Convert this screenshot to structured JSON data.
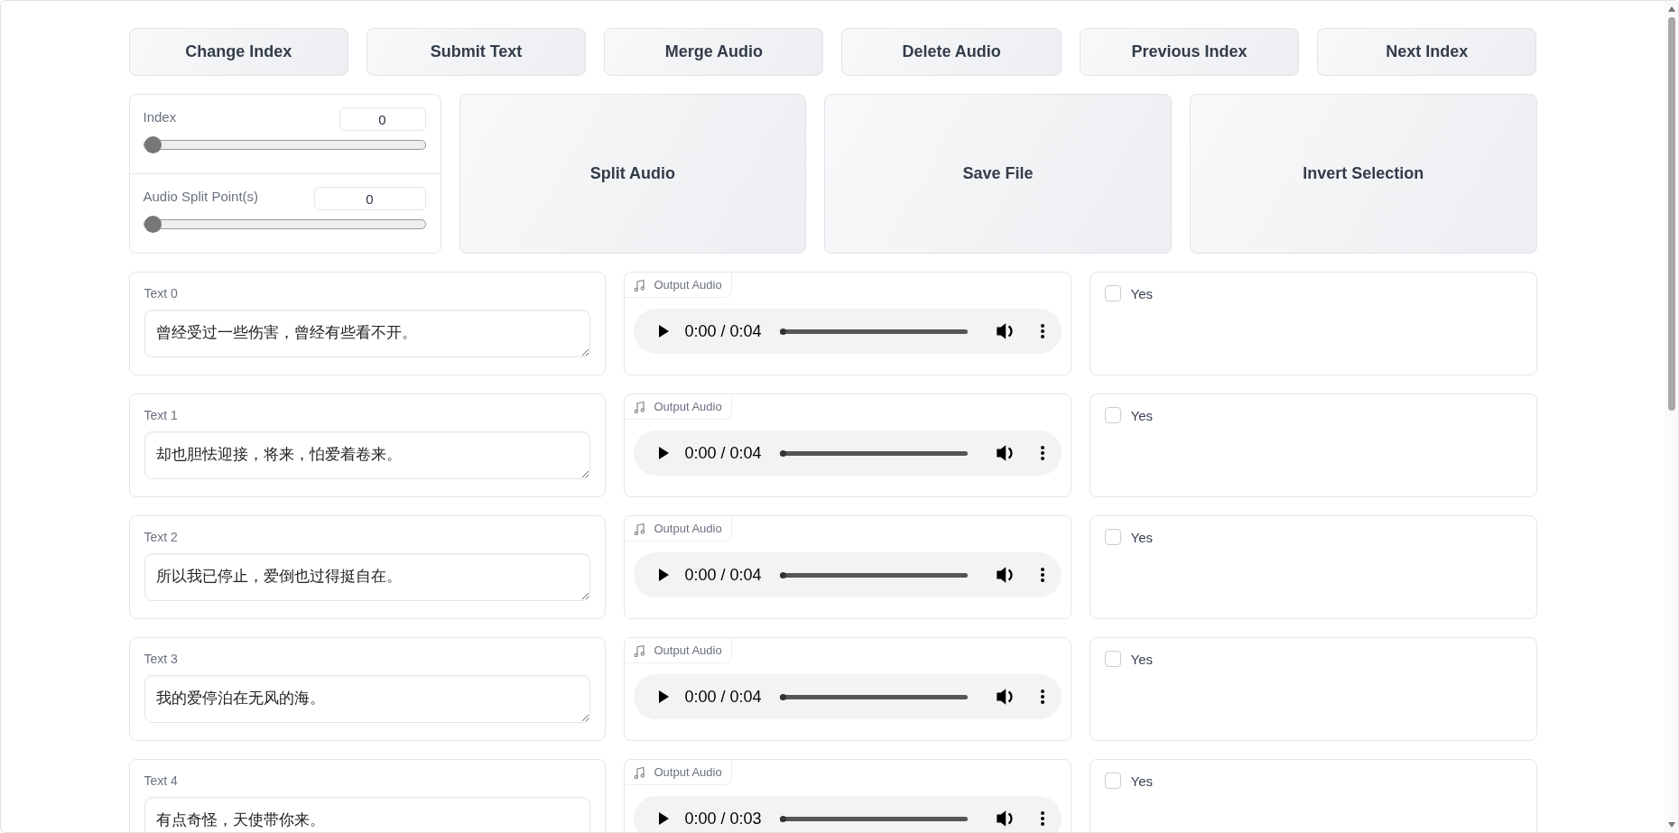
{
  "toolbar": {
    "buttons": [
      "Change Index",
      "Submit Text",
      "Merge Audio",
      "Delete Audio",
      "Previous Index",
      "Next Index"
    ]
  },
  "sliders": [
    {
      "label": "Index",
      "value": "0",
      "level": 0
    },
    {
      "label": "Audio Split Point(s)",
      "value": "0",
      "level": 0
    }
  ],
  "actions": [
    "Split Audio",
    "Save File",
    "Invert Selection"
  ],
  "rows": [
    {
      "text_label": "Text 0",
      "text": "曾经受过一些伤害，曾经有些看不开。",
      "audio_label": "Output Audio",
      "time": "0:00 / 0:04",
      "level": 0,
      "check_label": "Yes",
      "checked": false
    },
    {
      "text_label": "Text 1",
      "text": "却也胆怯迎接，将来，怕爱着卷来。",
      "audio_label": "Output Audio",
      "time": "0:00 / 0:04",
      "level": 0,
      "check_label": "Yes",
      "checked": false
    },
    {
      "text_label": "Text 2",
      "text": "所以我已停止，爱倒也过得挺自在。",
      "audio_label": "Output Audio",
      "time": "0:00 / 0:04",
      "level": 0,
      "check_label": "Yes",
      "checked": false
    },
    {
      "text_label": "Text 3",
      "text": "我的爱停泊在无风的海。",
      "audio_label": "Output Audio",
      "time": "0:00 / 0:04",
      "level": 0,
      "check_label": "Yes",
      "checked": false
    },
    {
      "text_label": "Text 4",
      "text": "有点奇怪，天使带你来。",
      "audio_label": "Output Audio",
      "time": "0:00 / 0:03",
      "level": 0,
      "check_label": "Yes",
      "checked": false
    }
  ]
}
